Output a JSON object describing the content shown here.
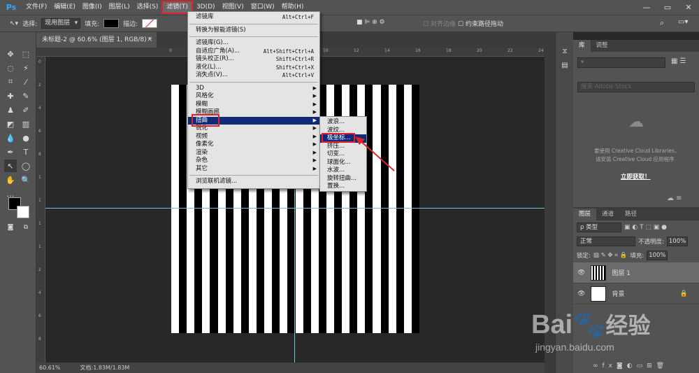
{
  "app": {
    "logo": "Ps"
  },
  "menubar": {
    "items": [
      "文件(F)",
      "编辑(E)",
      "图像(I)",
      "图层(L)",
      "选择(S)",
      "滤镜(T)",
      "3D(D)",
      "视图(V)",
      "窗口(W)",
      "帮助(H)"
    ],
    "active_index": 5
  },
  "window_controls": [
    "—",
    "▭",
    "✕"
  ],
  "options": {
    "select_label": "选择:",
    "select_value": "现用图层",
    "fill_label": "填充:",
    "stroke_label": "描边:",
    "align_edges": "对齐边缘",
    "constrain_path": "约束路径拖动"
  },
  "document": {
    "tab_title": "未标题-2 @ 60.6% (图层 1, RGB/8) *",
    "close": "×",
    "zoom": "60.61%",
    "doc_info": "文档:1.83M/1.83M",
    "stripe_count": 16,
    "ruler_h_marks": [
      "0",
      "2",
      "4",
      "6",
      "8",
      "10",
      "12",
      "14",
      "16",
      "18",
      "20",
      "22",
      "24"
    ],
    "ruler_v_marks": [
      "0",
      "2",
      "4",
      "6",
      "8",
      "1",
      "1",
      "1",
      "1",
      "2",
      "4",
      "6",
      "8"
    ]
  },
  "filter_menu": {
    "top": [
      {
        "label": "滤镜库",
        "shortcut": "Alt+Ctrl+F"
      },
      {
        "label": "转换为智能滤镜(S)",
        "shortcut": ""
      }
    ],
    "group2": [
      {
        "label": "滤镜库(G)...",
        "shortcut": ""
      },
      {
        "label": "自适应广角(A)...",
        "shortcut": "Alt+Shift+Ctrl+A"
      },
      {
        "label": "镜头校正(R)...",
        "shortcut": "Shift+Ctrl+R"
      },
      {
        "label": "液化(L)...",
        "shortcut": "Shift+Ctrl+X"
      },
      {
        "label": "消失点(V)...",
        "shortcut": "Alt+Ctrl+V"
      }
    ],
    "submenus": [
      "3D",
      "风格化",
      "模糊",
      "模糊画廊",
      "扭曲",
      "锐化",
      "视频",
      "像素化",
      "渲染",
      "杂色",
      "其它"
    ],
    "highlight_index": 4,
    "bottom": "浏览联机滤镜..."
  },
  "distort_menu": {
    "items": [
      "波浪...",
      "波纹...",
      "极坐标...",
      "挤压...",
      "切变...",
      "球面化...",
      "水波...",
      "旋转扭曲...",
      "置换..."
    ],
    "highlight_index": 2
  },
  "library_panel": {
    "tabs": [
      "库",
      "调整"
    ],
    "search_placeholder": "搜索 Adobe Stock",
    "message_line1": "要使用 Creative Cloud Libraries，",
    "message_line2": "请安装 Creative Cloud 应用程序",
    "link": "立即获取！"
  },
  "layers_panel": {
    "tabs": [
      "图层",
      "通道",
      "路径"
    ],
    "filter_type": "ρ 类型",
    "blend_mode": "正常",
    "opacity_label": "不透明度:",
    "opacity_value": "100%",
    "lock_label": "锁定:",
    "fill_label": "填充:",
    "fill_value": "100%",
    "layers": [
      {
        "name": "图层 1",
        "selected": true
      },
      {
        "name": "背景",
        "selected": false
      }
    ],
    "footer_icons": [
      "link-icon",
      "fx-icon",
      "mask-icon",
      "adjustment-icon",
      "group-icon",
      "new-layer-icon",
      "trash-icon"
    ]
  },
  "watermark": {
    "brand": "Bai",
    "brand2": "经验",
    "url": "jingyan.baidu.com"
  }
}
